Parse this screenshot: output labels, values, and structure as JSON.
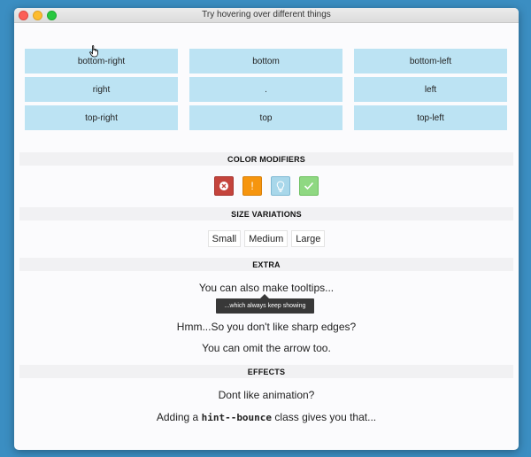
{
  "window": {
    "title": "Try hovering over different things"
  },
  "positions": [
    "bottom-right",
    "bottom",
    "bottom-left",
    "right",
    ".",
    "left",
    "top-right",
    "top",
    "top-left"
  ],
  "sections": {
    "color": "COLOR MODIFIERS",
    "size": "SIZE VARIATIONS",
    "extra": "EXTRA",
    "effects": "EFFECTS"
  },
  "color_buttons": [
    {
      "icon": "x-circle-icon",
      "color": "#c4443c"
    },
    {
      "icon": "exclamation-icon",
      "color": "#f6950e",
      "label": "!"
    },
    {
      "icon": "lightbulb-icon",
      "color": "#a8d7ea"
    },
    {
      "icon": "check-icon",
      "color": "#8fd882"
    }
  ],
  "sizes": [
    "Small",
    "Medium",
    "Large"
  ],
  "extra": {
    "line1": "You can also make tooltips...",
    "tooltip": "...which always keep showing",
    "line2": "Hmm...So you don't like sharp edges?",
    "line3": "You can omit the arrow too."
  },
  "effects": {
    "line1": "Dont like animation?",
    "line2_prefix": "Adding a ",
    "line2_code": "hint--bounce",
    "line2_suffix": " class gives you that..."
  }
}
